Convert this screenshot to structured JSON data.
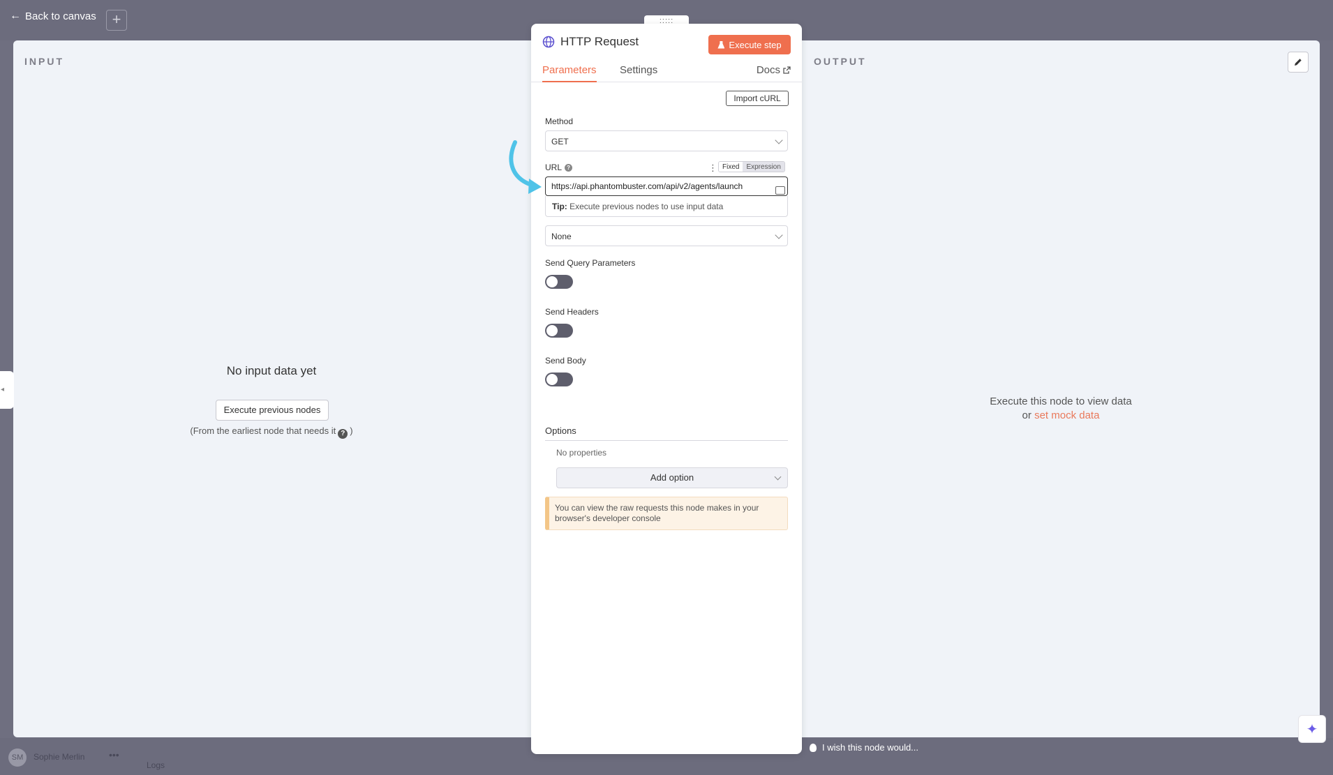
{
  "backdrop": {
    "back_label": "Back to canvas",
    "add_label": "+",
    "user_initials": "SM",
    "user_name": "Sophie Merlin",
    "user_more": "•••",
    "logs_label": "Logs",
    "wish_label": "I wish this node would..."
  },
  "input_panel": {
    "title": "INPUT",
    "empty_title": "No input data yet",
    "execute_previous_label": "Execute previous nodes",
    "hint_before": "(From the earliest node that needs it",
    "hint_after": ")"
  },
  "output_panel": {
    "title": "OUTPUT",
    "message": "Execute this node to view data",
    "or_text": "or",
    "mock_link": "set mock data"
  },
  "node": {
    "drag_handle": ":::::",
    "title": "HTTP Request",
    "execute_step_label": "Execute step",
    "tabs": [
      {
        "label": "Parameters",
        "active": true
      },
      {
        "label": "Settings",
        "active": false
      }
    ],
    "docs_label": "Docs",
    "import_curl_label": "Import cURL",
    "method": {
      "label": "Method",
      "value": "GET"
    },
    "url": {
      "label": "URL",
      "mode_fixed": "Fixed",
      "mode_expression": "Expression",
      "value": "https://api.phantombuster.com/api/v2/agents/launch"
    },
    "tip": {
      "prefix": "Tip:",
      "text": "Execute previous nodes to use input data"
    },
    "auth": {
      "value": "None"
    },
    "send_query": {
      "label": "Send Query Parameters",
      "on": false
    },
    "send_headers": {
      "label": "Send Headers",
      "on": false
    },
    "send_body": {
      "label": "Send Body",
      "on": false
    },
    "options": {
      "title": "Options",
      "no_properties": "No properties",
      "add_option_label": "Add option"
    },
    "notice": "You can view the raw requests this node makes in your browser's developer console"
  },
  "colors": {
    "accent": "#ef6f4e",
    "hint_arrow": "#4fc3e8",
    "ai_icon": "#6b5ce7"
  }
}
